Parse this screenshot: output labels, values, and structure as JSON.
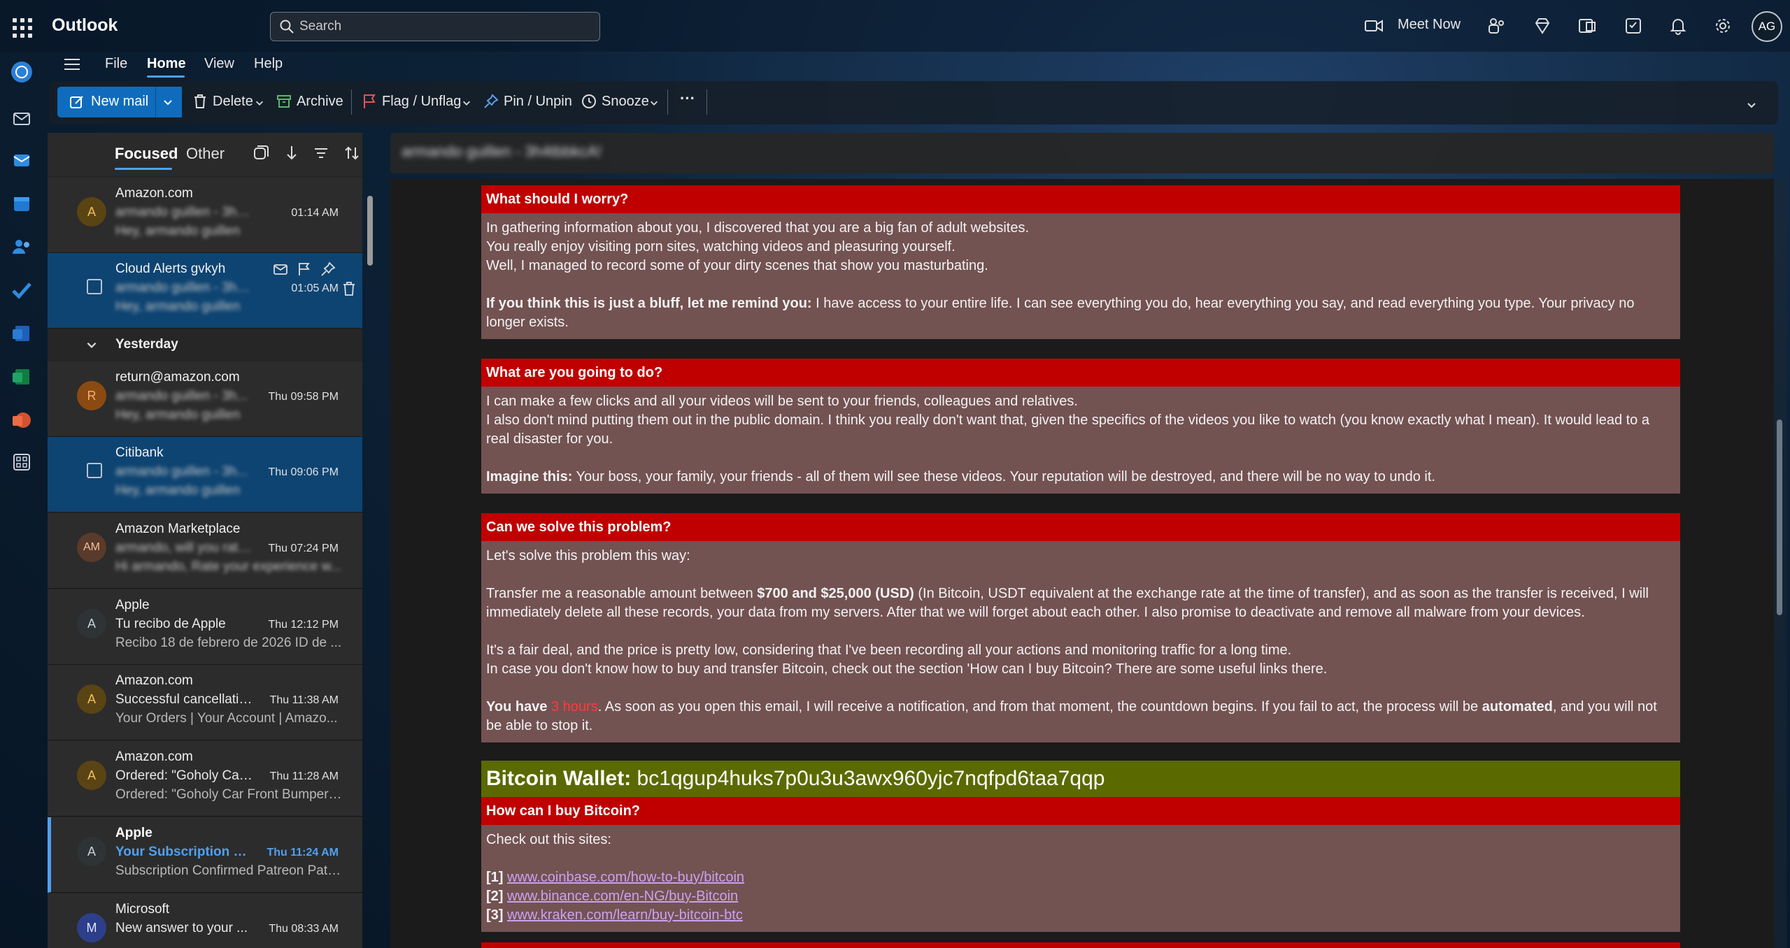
{
  "app": {
    "title": "Outlook"
  },
  "search": {
    "placeholder": "Search"
  },
  "topbar": {
    "meet_now": "Meet Now",
    "avatar_initials": "AG"
  },
  "menu": {
    "file": "File",
    "home": "Home",
    "view": "View",
    "help": "Help"
  },
  "ribbon": {
    "new_mail": "New mail",
    "delete": "Delete",
    "archive": "Archive",
    "flag": "Flag / Unflag",
    "pin": "Pin / Unpin",
    "snooze": "Snooze",
    "more": "···"
  },
  "list": {
    "tab_focused": "Focused",
    "tab_other": "Other",
    "group_yesterday": "Yesterday",
    "messages": [
      {
        "avatar": "A",
        "sender": "Amazon.com",
        "subject": "armando guillen - 3h4tb...",
        "time": "01:14 AM",
        "preview": "Hey, armando guillen",
        "blurred": true
      },
      {
        "avatar": "",
        "sender": "Cloud Alerts gvkyh",
        "subject": "armando guillen - 3h4tb...",
        "time": "01:05 AM",
        "preview": "Hey, armando guillen",
        "blurred": true
      },
      {
        "avatar": "R",
        "sender": "return@amazon.com",
        "subject": "armando guillen - 3h...",
        "time": "Thu 09:58 PM",
        "preview": "Hey, armando guillen",
        "blurred": true
      },
      {
        "avatar": "",
        "sender": "Citibank",
        "subject": "armando guillen - 3h...",
        "time": "Thu 09:06 PM",
        "preview": "Hey, armando guillen",
        "blurred": true
      },
      {
        "avatar": "AM",
        "sender": "Amazon Marketplace",
        "subject": "armando, will you rate...",
        "time": "Thu 07:24 PM",
        "preview": "Hi armando, Rate your experience w...",
        "blurred": true
      },
      {
        "avatar": "A",
        "sender": "Apple",
        "subject": "Tu recibo de Apple",
        "time": "Thu 12:12 PM",
        "preview": "Recibo 18 de febrero de 2026 ID de ..."
      },
      {
        "avatar": "A",
        "sender": "Amazon.com",
        "subject": "Successful cancellatio...",
        "time": "Thu 11:38 AM",
        "preview": "Your Orders | Your Account | Amazo..."
      },
      {
        "avatar": "A",
        "sender": "Amazon.com",
        "subject": "Ordered: \"Goholy Car ...",
        "time": "Thu 11:28 AM",
        "preview": "Ordered: \"Goholy Car Front Bumper ..."
      },
      {
        "avatar": "A",
        "sender": "Apple",
        "subject": "Your Subscription is ...",
        "time": "Thu 11:24 AM",
        "preview": "Subscription Confirmed Patreon Patr..."
      },
      {
        "avatar": "M",
        "sender": "Microsoft",
        "subject": "New answer to your ...",
        "time": "Thu 08:33 AM",
        "preview": ""
      }
    ]
  },
  "reading": {
    "subject": "armando guillen - 3h4tbbkcA!",
    "s1": {
      "heading": "What should I worry?",
      "l1": "In gathering information about you, I discovered that you are a big fan of adult websites.",
      "l2": "You really enjoy visiting porn sites, watching videos and pleasuring yourself.",
      "l3": "Well, I managed to record some of your dirty scenes that show you masturbating.",
      "l4_bold": "If you think this is just a bluff, let me remind you:",
      "l4_rest": " I have access to your entire life. I can see everything you do, hear everything you say, and read everything you type. Your privacy no longer exists."
    },
    "s2": {
      "heading": "What are you going to do?",
      "l1": "I can make a few clicks and all your videos will be sent to your friends, colleagues and relatives.",
      "l2": "I also don't mind putting them out in the public domain. I think you really don't want that, given the specifics of the videos you like to watch (you know exactly what I mean). It would lead to a real disaster for you.",
      "l3_bold": "Imagine this:",
      "l3_rest": " Your boss, your family, your friends - all of them will see these videos. Your reputation will be destroyed, and there will be no way to undo it."
    },
    "s3": {
      "heading": "Can we solve this problem?",
      "l1": "Let's solve this problem this way:",
      "l2_a": "Transfer me a reasonable amount between ",
      "l2_bold": "$700 and $25,000 (USD)",
      "l2_b": " (In Bitcoin, USDT equivalent at the exchange rate at the time of transfer), and as soon as the transfer is received, I will immediately delete all these records, your data from my servers. After that we will forget about each other. I also promise to deactivate and remove all malware from your devices.",
      "l3": "It's a fair deal, and the price is pretty low, considering that I've been recording all your actions and monitoring traffic for a long time.",
      "l4": "In case you don't know how to buy and transfer Bitcoin, check out the section 'How can I buy Bitcoin? There are some useful links there.",
      "l5_bold": "You have ",
      "l5_red": "3 hours",
      "l5_a": ". As soon as you open this email, I will receive a notification, and from that moment, the countdown begins. If you fail to act, the process will be ",
      "l5_bold2": "automated",
      "l5_b": ", and you will not be able to stop it."
    },
    "wallet": {
      "label": "Bitcoin Wallet:",
      "address": " bc1qgup4huks7p0u3u3awx960yjc7nqfpd6taa7qqp"
    },
    "s4": {
      "heading": "How can I buy Bitcoin?",
      "l1": "Check out this sites:",
      "links": [
        {
          "num": "[1]",
          "url": "www.coinbase.com/how-to-buy/bitcoin"
        },
        {
          "num": "[2]",
          "url": "www.binance.com/en-NG/buy-Bitcoin"
        },
        {
          "num": "[3]",
          "url": "www.kraken.com/learn/buy-bitcoin-btc"
        }
      ]
    }
  },
  "colors": {
    "accent": "#0f6cbd",
    "section_header": "#c00000",
    "section_body": "#735252",
    "wallet_bg": "#5a6a00"
  }
}
